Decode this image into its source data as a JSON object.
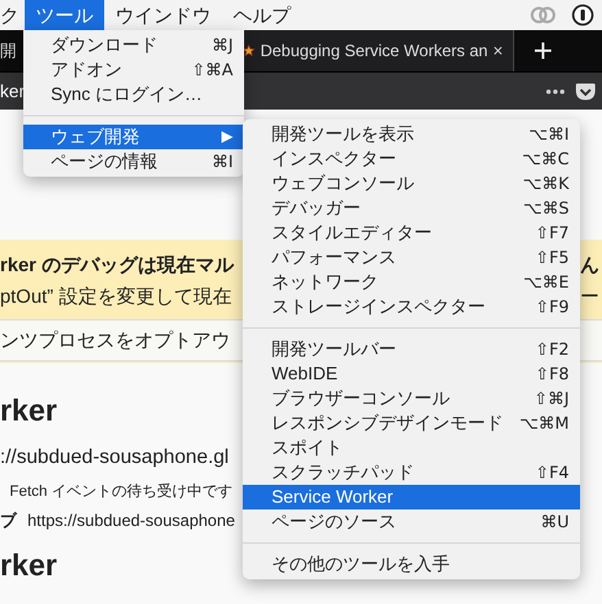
{
  "menubar": {
    "items": [
      {
        "label": "ク",
        "selected": false
      },
      {
        "label": "ツール",
        "selected": true
      },
      {
        "label": "ウインドウ",
        "selected": false
      },
      {
        "label": "ヘルプ",
        "selected": false
      }
    ]
  },
  "tabs": [
    {
      "label": "開",
      "kind": "plain"
    },
    {
      "label": "Debugging Service Workers an",
      "kind": "starred"
    }
  ],
  "address_text": "ker",
  "banner": {
    "line_1": "rker のデバッグは現在マル",
    "line_2": "ptOut” 設定を変更して現在",
    "box_text": "ンツプロセスをオプトアウ",
    "right_1": "ん",
    "right_2": "ー"
  },
  "content": {
    "heading_1": "rker",
    "url": "://subdued-sousaphone.gl",
    "status": "Fetch イベントの待ち受け中です",
    "scope_label": "ブ",
    "scope_url": "https://subdued-sousaphone",
    "heading_2": "rker"
  },
  "tools_menu": {
    "items": [
      {
        "kind": "item",
        "label": "ダウンロード",
        "shortcut": "⌘J",
        "selected": false
      },
      {
        "kind": "item",
        "label": "アドオン",
        "shortcut": "⇧⌘A",
        "selected": false
      },
      {
        "kind": "item",
        "label": "Sync にログイン…",
        "selected": false
      },
      {
        "kind": "separator"
      },
      {
        "kind": "submenu",
        "label": "ウェブ開発",
        "arrow": "▶",
        "selected": true
      },
      {
        "kind": "item",
        "label": "ページの情報",
        "shortcut": "⌘I",
        "selected": false
      }
    ]
  },
  "web_dev_menu": {
    "items": [
      {
        "kind": "item",
        "label": "開発ツールを表示",
        "shortcut": "⌥⌘I",
        "selected": false
      },
      {
        "kind": "item",
        "label": "インスペクター",
        "shortcut": "⌥⌘C",
        "selected": false
      },
      {
        "kind": "item",
        "label": "ウェブコンソール",
        "shortcut": "⌥⌘K",
        "selected": false
      },
      {
        "kind": "item",
        "label": "デバッガー",
        "shortcut": "⌥⌘S",
        "selected": false
      },
      {
        "kind": "item",
        "label": "スタイルエディター",
        "shortcut": "⇧F7",
        "selected": false
      },
      {
        "kind": "item",
        "label": "パフォーマンス",
        "shortcut": "⇧F5",
        "selected": false
      },
      {
        "kind": "item",
        "label": "ネットワーク",
        "shortcut": "⌥⌘E",
        "selected": false
      },
      {
        "kind": "item",
        "label": "ストレージインスペクター",
        "shortcut": "⇧F9",
        "selected": false
      },
      {
        "kind": "separator"
      },
      {
        "kind": "item",
        "label": "開発ツールバー",
        "shortcut": "⇧F2",
        "selected": false
      },
      {
        "kind": "item",
        "label": "WebIDE",
        "shortcut": "⇧F8",
        "selected": false
      },
      {
        "kind": "item",
        "label": "ブラウザーコンソール",
        "shortcut": "⇧⌘J",
        "selected": false
      },
      {
        "kind": "item",
        "label": "レスポンシブデザインモード",
        "shortcut": "⌥⌘M",
        "selected": false
      },
      {
        "kind": "item",
        "label": "スポイト",
        "selected": false
      },
      {
        "kind": "item",
        "label": "スクラッチパッド",
        "shortcut": "⇧F4",
        "selected": false
      },
      {
        "kind": "item",
        "label": "Service Worker",
        "selected": true
      },
      {
        "kind": "item",
        "label": "ページのソース",
        "shortcut": "⌘U",
        "selected": false
      },
      {
        "kind": "separator"
      },
      {
        "kind": "item",
        "label": "その他のツールを入手",
        "selected": false
      }
    ]
  }
}
